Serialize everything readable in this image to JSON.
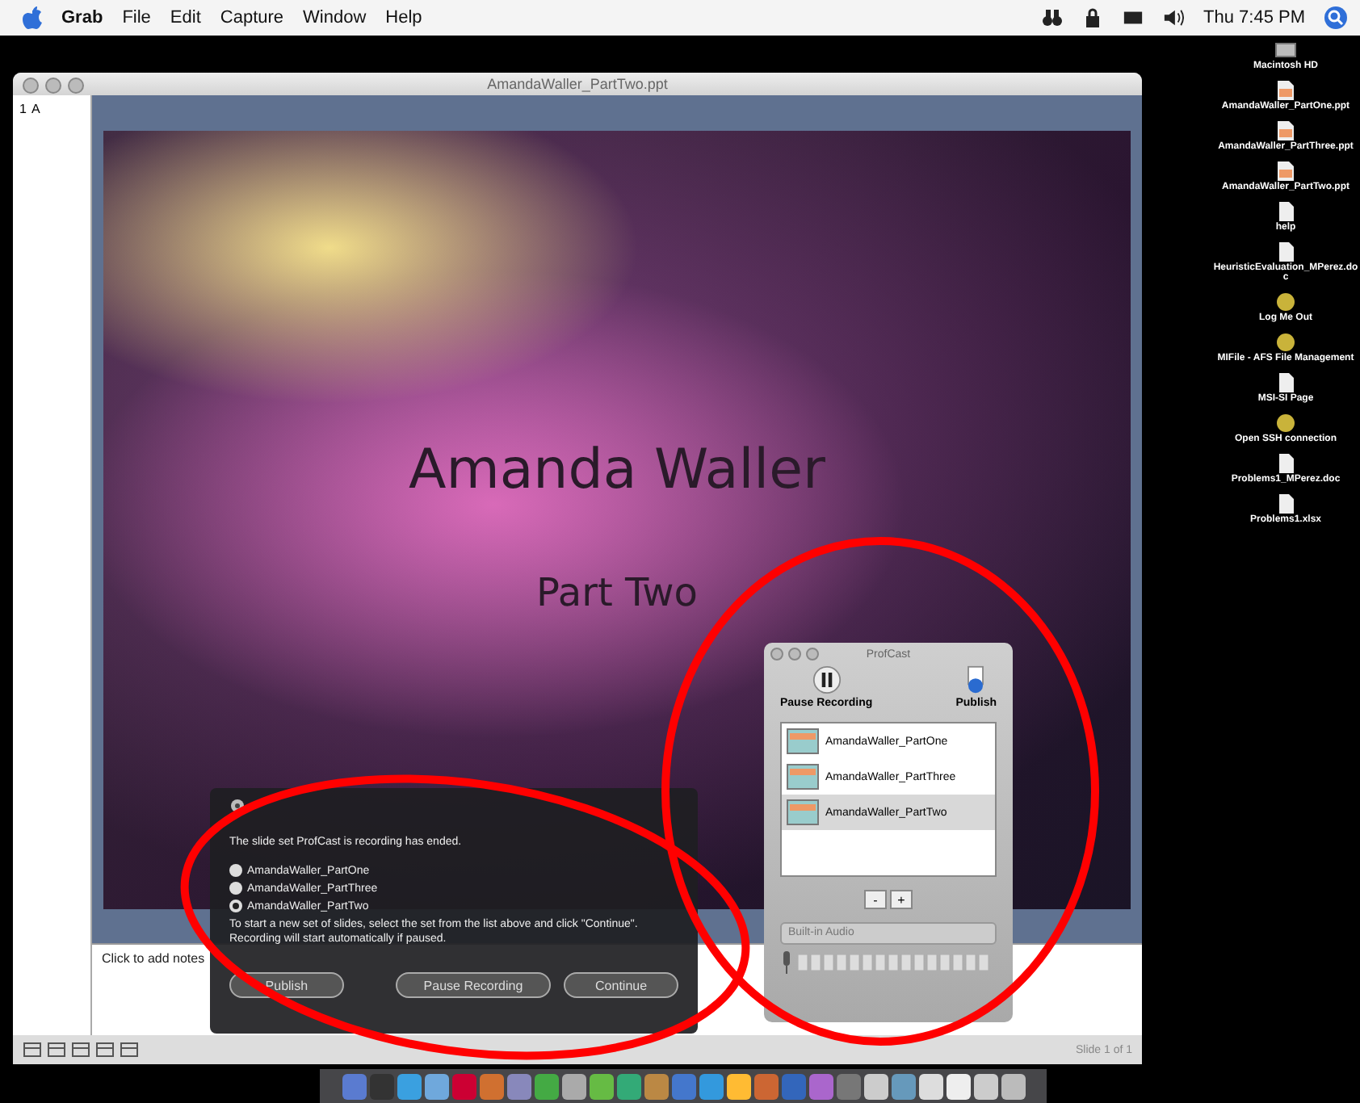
{
  "menu_bar": {
    "app": "Grab",
    "menus": [
      "File",
      "Edit",
      "Capture",
      "Window",
      "Help"
    ],
    "clock": "Thu 7:45 PM"
  },
  "window": {
    "title": "AmandaWaller_PartTwo.ppt",
    "outline": {
      "number": "1",
      "label": "A"
    },
    "slide": {
      "title": "Amanda Waller",
      "subtitle": "Part Two"
    },
    "notes": {
      "placeholder": "Click to add notes"
    },
    "status": "Slide 1 of 1"
  },
  "profcast_panel": {
    "title": "ProfCast",
    "pause_label": "Pause Recording",
    "publish_label": "Publish",
    "items": [
      {
        "label": "AmandaWaller_PartOne",
        "selected": false
      },
      {
        "label": "AmandaWaller_PartThree",
        "selected": false
      },
      {
        "label": "AmandaWaller_PartTwo",
        "selected": true
      }
    ],
    "remove": "-",
    "add": "+",
    "input": "Built-in Audio"
  },
  "dialog": {
    "message": "The slide set ProfCast is recording has ended.",
    "options": [
      {
        "label": "AmandaWaller_PartOne",
        "selected": false
      },
      {
        "label": "AmandaWaller_PartThree",
        "selected": false
      },
      {
        "label": "AmandaWaller_PartTwo",
        "selected": true
      }
    ],
    "hint": "To start a new set of slides, select the set from the list above and click \"Continue\". Recording will start automatically if paused.",
    "buttons": [
      "Publish",
      "Pause Recording",
      "Continue"
    ]
  },
  "desktop_icons": [
    {
      "kind": "disk",
      "label": "Macintosh HD"
    },
    {
      "kind": "presentation",
      "label": "AmandaWaller_PartOne.ppt"
    },
    {
      "kind": "presentation",
      "label": "AmandaWaller_PartThree.ppt"
    },
    {
      "kind": "presentation",
      "label": "AmandaWaller_PartTwo.ppt"
    },
    {
      "kind": "document",
      "label": "help"
    },
    {
      "kind": "document",
      "label": "HeuristicEvaluation_MPerez.doc"
    },
    {
      "kind": "app",
      "label": "Log Me Out"
    },
    {
      "kind": "app",
      "label": "MIFile - AFS File Management"
    },
    {
      "kind": "document",
      "label": "MSI-SI Page"
    },
    {
      "kind": "app",
      "label": "Open SSH connection"
    },
    {
      "kind": "document",
      "label": "Problems1_MPerez.doc"
    },
    {
      "kind": "document",
      "label": "Problems1.xlsx"
    }
  ]
}
